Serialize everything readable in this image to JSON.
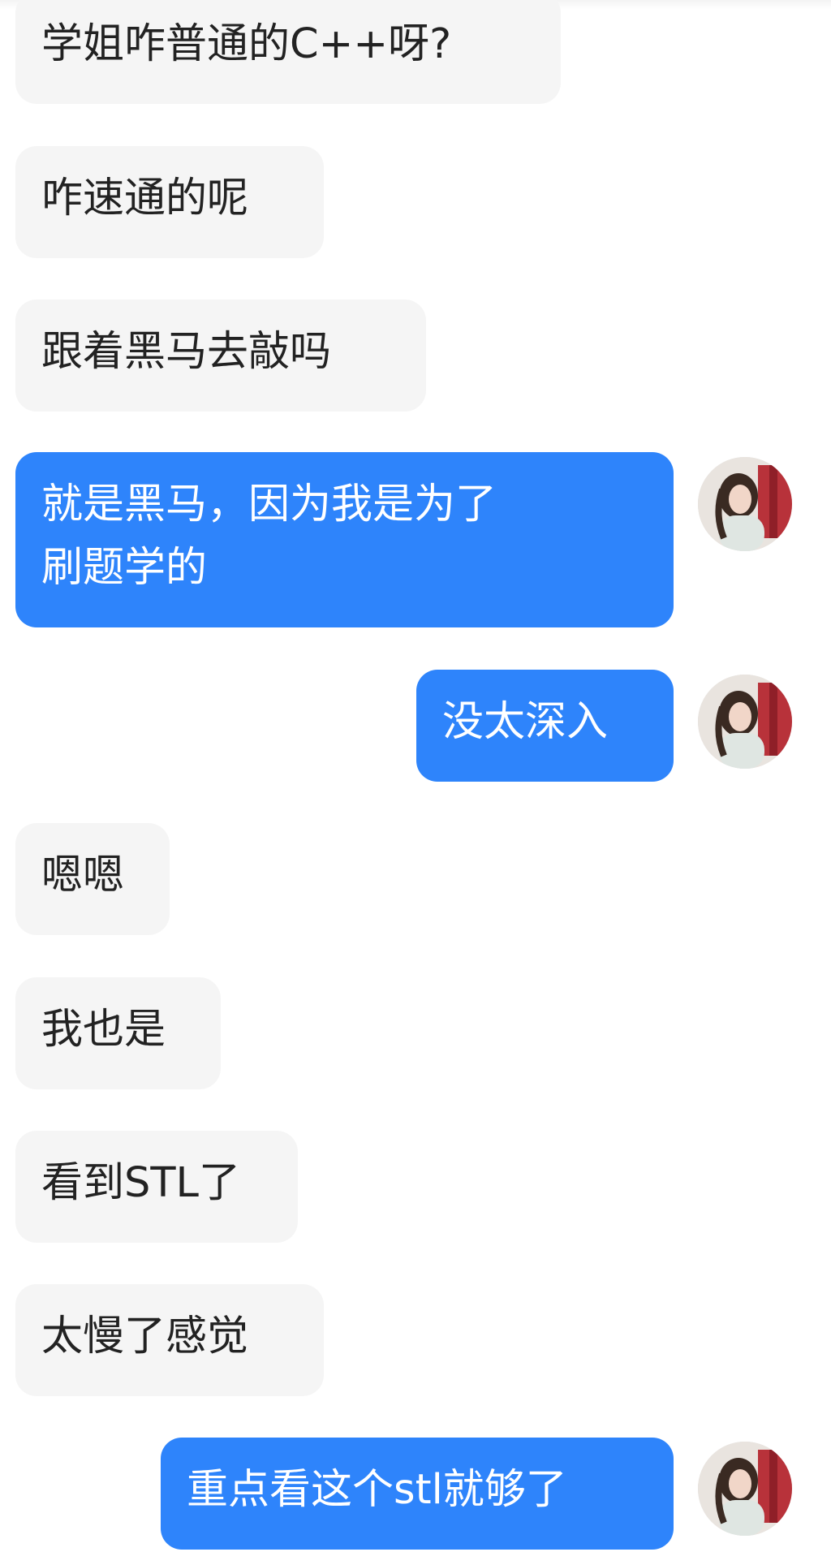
{
  "messages": [
    {
      "side": "received",
      "text": "学姐咋普通的C++呀?"
    },
    {
      "side": "received",
      "text": "咋速通的呢"
    },
    {
      "side": "received",
      "text": "跟着黑马去敲吗"
    },
    {
      "side": "sent",
      "text": "就是黑马，因为我是为了\n刷题学的",
      "avatar": "user-avatar"
    },
    {
      "side": "sent",
      "text": "没太深入",
      "avatar": "user-avatar"
    },
    {
      "side": "received",
      "text": "嗯嗯"
    },
    {
      "side": "received",
      "text": "我也是"
    },
    {
      "side": "received",
      "text": "看到STL了"
    },
    {
      "side": "received",
      "text": "太慢了感觉"
    },
    {
      "side": "sent",
      "text": "重点看这个stl就够了",
      "avatar": "user-avatar"
    }
  ],
  "colors": {
    "received_bubble": "#f5f5f5",
    "received_text": "#222222",
    "sent_bubble": "#2e84fb",
    "sent_text": "#ffffff"
  }
}
